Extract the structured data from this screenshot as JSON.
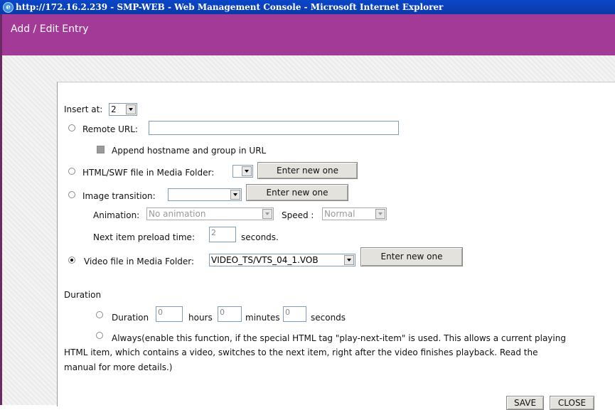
{
  "window": {
    "title": "http://172.16.2.239 - SMP-WEB - Web Management Console - Microsoft Internet Explorer",
    "icon": "ie-icon"
  },
  "header": {
    "title": "Add / Edit Entry"
  },
  "form": {
    "insert_at_label": "Insert at:",
    "insert_at_value": "2",
    "remote_url_label": "Remote URL:",
    "remote_url_value": "",
    "append_label": "Append hostname and group in URL",
    "html_swf_label": "HTML/SWF file in Media Folder:",
    "html_swf_value": "",
    "enter_new_label": "Enter new one",
    "image_transition_label": "Image transition:",
    "image_transition_value": "",
    "animation_label": "Animation:",
    "animation_value": "No animation",
    "speed_label": "Speed :",
    "speed_value": "Normal",
    "preload_label": "Next item preload time:",
    "preload_value": "2",
    "seconds_unit": "seconds.",
    "video_label": "Video file in Media Folder:",
    "video_value": "VIDEO_TS/VTS_04_1.VOB",
    "selected_option": "video"
  },
  "duration": {
    "section_label": "Duration",
    "duration_label": "Duration",
    "hours_value": "0",
    "hours_label": "hours",
    "minutes_value": "0",
    "minutes_label": "minutes",
    "seconds_value": "0",
    "seconds_label": "seconds",
    "always_line1": "Always(enable this function, if the special HTML tag \"play-next-item\" is used. This allows a current playing",
    "always_line2": "HTML item, which contains a video, switches to the next item, right after the video finishes playback. Read the",
    "always_line3": "manual for more details.)"
  },
  "buttons": {
    "save": "SAVE",
    "close": "CLOSE"
  },
  "colors": {
    "header": "#a43a98",
    "titlebar": "#0a46c8"
  }
}
